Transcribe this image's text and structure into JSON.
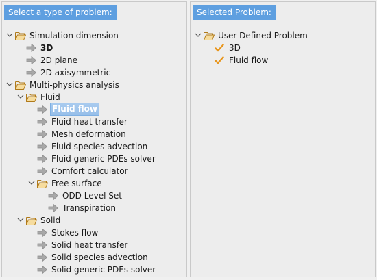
{
  "left_panel": {
    "header": "Select a type of problem:",
    "tree": [
      {
        "label": "Simulation dimension",
        "type": "folder",
        "level": 0,
        "expanded": true
      },
      {
        "label": "3D",
        "type": "leaf",
        "level": 1,
        "bold": true
      },
      {
        "label": "2D plane",
        "type": "leaf",
        "level": 1
      },
      {
        "label": "2D axisymmetric",
        "type": "leaf",
        "level": 1
      },
      {
        "label": "Multi-physics analysis",
        "type": "folder",
        "level": 0,
        "expanded": true
      },
      {
        "label": "Fluid",
        "type": "folder",
        "level": 1,
        "expanded": true
      },
      {
        "label": "Fluid flow",
        "type": "leaf",
        "level": 2,
        "selected": true
      },
      {
        "label": "Fluid heat transfer",
        "type": "leaf",
        "level": 2
      },
      {
        "label": "Mesh deformation",
        "type": "leaf",
        "level": 2
      },
      {
        "label": "Fluid species advection",
        "type": "leaf",
        "level": 2
      },
      {
        "label": "Fluid generic PDEs solver",
        "type": "leaf",
        "level": 2
      },
      {
        "label": "Comfort calculator",
        "type": "leaf",
        "level": 2
      },
      {
        "label": "Free surface",
        "type": "folder",
        "level": 2,
        "expanded": true
      },
      {
        "label": "ODD Level Set",
        "type": "leaf",
        "level": 3
      },
      {
        "label": "Transpiration",
        "type": "leaf",
        "level": 3
      },
      {
        "label": "Solid",
        "type": "folder",
        "level": 1,
        "expanded": true
      },
      {
        "label": "Stokes flow",
        "type": "leaf",
        "level": 2
      },
      {
        "label": "Solid heat transfer",
        "type": "leaf",
        "level": 2
      },
      {
        "label": "Solid species advection",
        "type": "leaf",
        "level": 2
      },
      {
        "label": "Solid generic PDEs solver",
        "type": "leaf",
        "level": 2
      }
    ]
  },
  "right_panel": {
    "header": "Selected Problem:",
    "tree": [
      {
        "label": "User Defined Problem",
        "type": "folder",
        "level": 0,
        "expanded": true
      },
      {
        "label": "3D",
        "type": "check",
        "level": 1
      },
      {
        "label": "Fluid flow",
        "type": "check",
        "level": 1
      }
    ]
  },
  "colors": {
    "header_bg": "#5e9fe0",
    "check": "#e8961e",
    "folder": "#e8b04a"
  },
  "icons": {
    "folder": "folder-open-icon",
    "leaf": "arrow-right-icon",
    "check": "check-icon",
    "toggle": "chevron-down-icon"
  }
}
